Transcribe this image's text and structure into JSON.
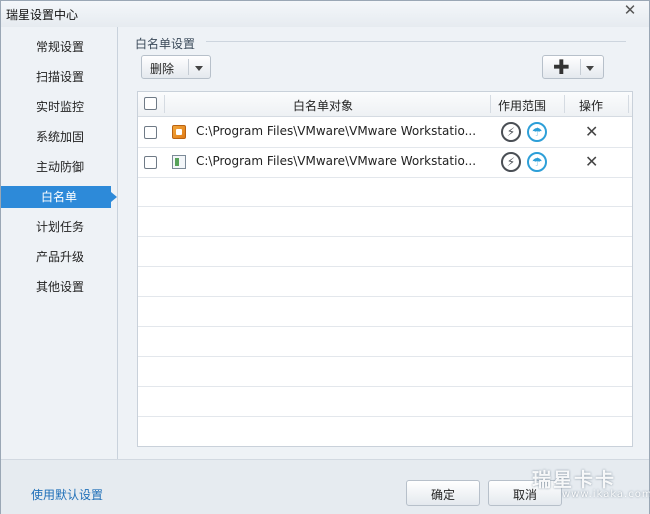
{
  "window": {
    "title": "瑞星设置中心",
    "close_label": "✕"
  },
  "sidebar": {
    "items": [
      {
        "label": "常规设置"
      },
      {
        "label": "扫描设置"
      },
      {
        "label": "实时监控"
      },
      {
        "label": "系统加固"
      },
      {
        "label": "主动防御"
      },
      {
        "label": "白名单",
        "active": true
      },
      {
        "label": "计划任务"
      },
      {
        "label": "产品升级"
      },
      {
        "label": "其他设置"
      }
    ]
  },
  "main": {
    "section_title": "白名单设置",
    "delete_button": "删除",
    "add_button": "✚",
    "table": {
      "headers": {
        "object": "白名单对象",
        "scope": "作用范围",
        "action": "操作"
      },
      "rows": [
        {
          "icon": "vmware-app-icon",
          "path": "C:\\Program Files\\VMware\\VMware Workstatio...",
          "remove": "✕"
        },
        {
          "icon": "generic-app-icon",
          "path": "C:\\Program Files\\VMware\\VMware Workstatio...",
          "remove": "✕"
        }
      ]
    }
  },
  "footer": {
    "default_link": "使用默认设置",
    "ok_button": "确定",
    "cancel_button": "取消"
  },
  "watermark": {
    "main": "瑞星卡卡",
    "sub": "www.ikaka.com"
  },
  "colors": {
    "accent": "#2d8ad9",
    "link": "#1f6fb8",
    "umbrella": "#2d9fd8"
  }
}
